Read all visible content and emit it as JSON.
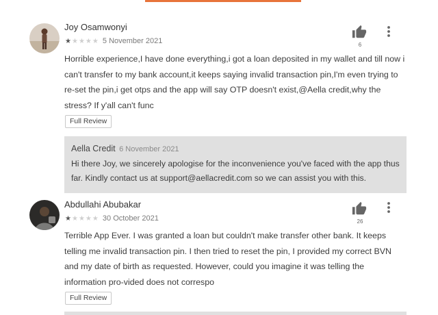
{
  "reviews": [
    {
      "author": "Joy Osamwonyi",
      "rating": 1,
      "date": "5 November 2021",
      "likes": "6",
      "text": "Horrible experience,I have done everything,i got a loan deposited in my wallet and till now i can't transfer to my bank account,it keeps saying invalid transaction pin,I'm even trying to re-set the pin,i get otps and the app will say OTP doesn't exist,@Aella credit,why the stress? If y'all can't func",
      "full_review_label": "Full Review",
      "reply": {
        "author": "Aella Credit",
        "date": "6 November 2021",
        "text": "Hi there Joy, we sincerely apologise for the inconvenience you've faced with the app thus far. Kindly contact us at support@aellacredit.com so we can assist you with this."
      }
    },
    {
      "author": "Abdullahi Abubakar",
      "rating": 1,
      "date": "30 October 2021",
      "likes": "26",
      "text": "Terrible App Ever. I was granted a loan but couldn't make transfer other bank. It keeps telling me invalid transaction pin. I then tried to reset the pin, I provided my correct BVN and my date of birth as requested. However, could you imagine it was telling the information pro-vided does not correspo",
      "full_review_label": "Full Review"
    }
  ],
  "stars": {
    "filled": "★",
    "empty": "★"
  },
  "colors": {
    "accent": "#e8743b",
    "reply_bg": "#e0e0e0"
  }
}
